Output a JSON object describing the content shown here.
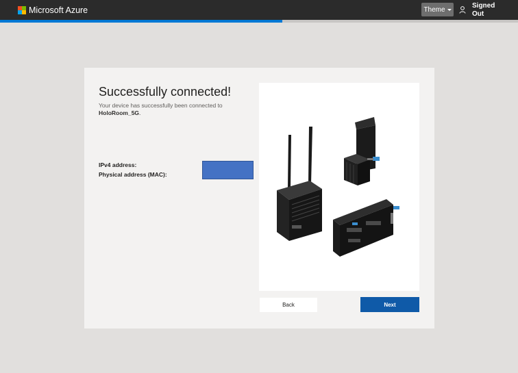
{
  "header": {
    "brand": "Microsoft Azure",
    "logo_colors": [
      "#f25022",
      "#7fba00",
      "#00a4ef",
      "#ffb900"
    ],
    "theme_label": "Theme",
    "user_label": "Signed Out",
    "user_icon": "person-icon",
    "theme_caret_icon": "chevron-down-icon"
  },
  "progress": {
    "fraction": 0.545,
    "color": "#0078d4"
  },
  "main": {
    "title": "Successfully connected!",
    "subtitle": "Your device has successfully been connected to",
    "network_name": "HoloRoom_5G",
    "network_suffix": ".",
    "fields": [
      {
        "label": "IPv4 address:"
      },
      {
        "label": "Physical address (MAC):"
      }
    ],
    "device_image_icon": "device-hardware-image",
    "back_label": "Back",
    "next_label": "Next"
  },
  "colors": {
    "accent": "#0078d4",
    "primary_button": "#0f5aa8",
    "redaction": "#4472c4"
  }
}
